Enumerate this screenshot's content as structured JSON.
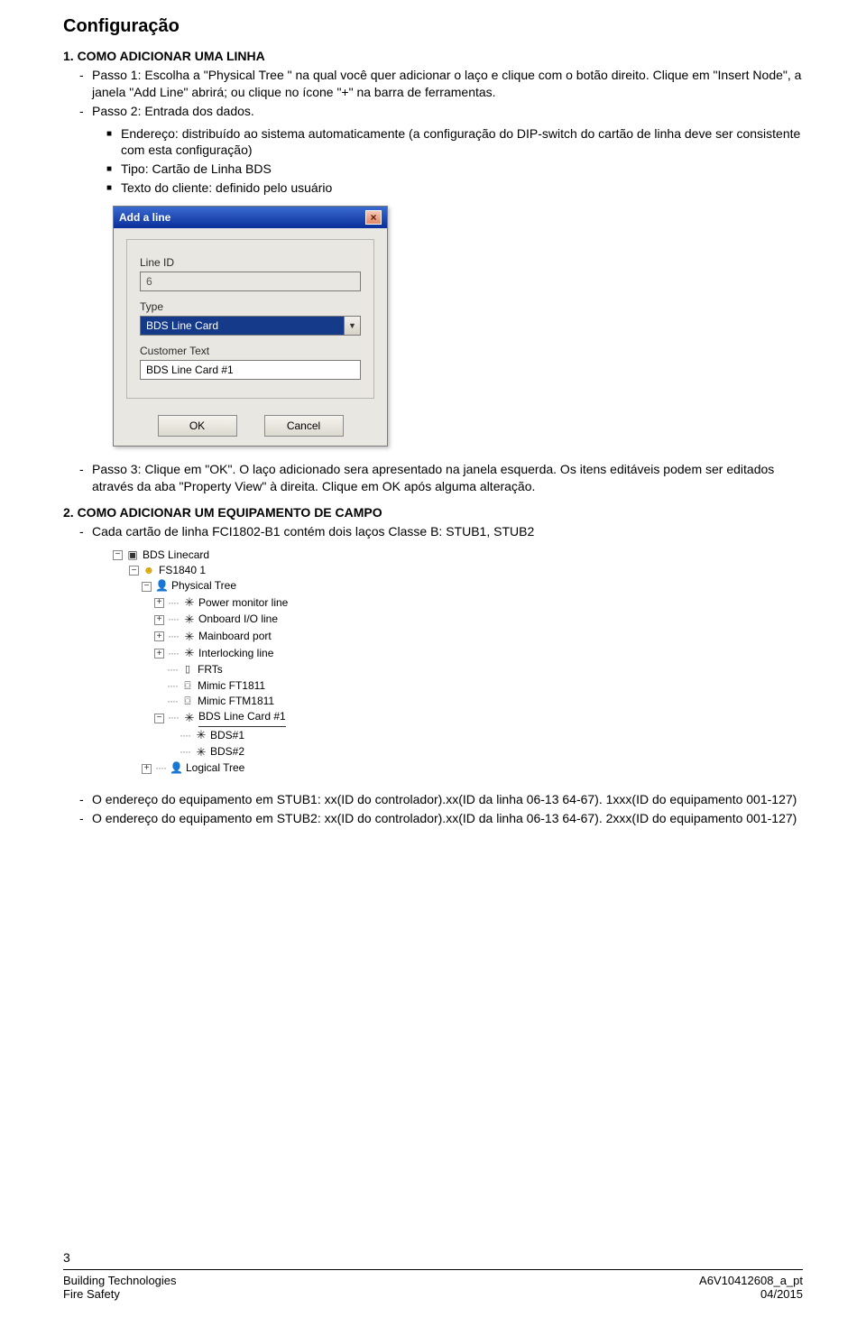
{
  "section_title": "Configuração",
  "h1_num": "1. COMO ADICIONAR UMA LINHA",
  "p1": "Passo 1: Escolha a \"Physical Tree \" na qual você quer adicionar o laço e clique com o botão direito. Clique em \"Insert Node\", a janela \"Add Line\" abrirá; ou clique no ícone \"+\" na barra de ferramentas.",
  "p2": "Passo 2: Entrada dos dados.",
  "sq": {
    "a": "Endereço: distribuído ao sistema automaticamente (a configuração do DIP-switch do cartão de linha deve ser consistente com esta configuração)",
    "b": "Tipo: Cartão de Linha BDS",
    "c": "Texto do cliente: definido pelo usuário"
  },
  "dialog": {
    "title": "Add a line",
    "line_id_label": "Line ID",
    "line_id_value": "6",
    "type_label": "Type",
    "type_value": "BDS Line Card",
    "ctext_label": "Customer Text",
    "ctext_value": "BDS Line Card #1",
    "ok": "OK",
    "cancel": "Cancel"
  },
  "p3": "Passo 3: Clique em \"OK\". O laço adicionado sera apresentado na janela esquerda. Os itens editáveis podem ser editados através da aba \"Property View\" à direita. Clique em OK após alguma alteração.",
  "h2_num": "2. COMO ADICIONAR UM EQUIPAMENTO DE CAMPO",
  "p4": "Cada cartão de linha FCI1802-B1 contém dois laços Classe B: STUB1, STUB2",
  "tree": {
    "n0": "BDS Linecard",
    "n1": "FS1840 1",
    "n2": "Physical Tree",
    "n3": "Power monitor line",
    "n4": "Onboard I/O line",
    "n5": "Mainboard port",
    "n6": "Interlocking line",
    "n7": "FRTs",
    "n8": "Mimic FT1811",
    "n9": "Mimic FTM1811",
    "n10": "BDS Line Card #1",
    "n11": "BDS#1",
    "n12": "BDS#2",
    "n13": "Logical Tree"
  },
  "p5": "O endereço do equipamento em STUB1: xx(ID do controlador).xx(ID da linha 06-13 64-67). 1xxx(ID do equipamento 001-127)",
  "p6": "O endereço do equipamento em STUB2: xx(ID do controlador).xx(ID da linha 06-13 64-67). 2xxx(ID do equipamento 001-127)",
  "page_num": "3",
  "footer": {
    "l1": "Building Technologies",
    "r1": "A6V10412608_a_pt",
    "l2": "Fire Safety",
    "r2": "04/2015"
  }
}
